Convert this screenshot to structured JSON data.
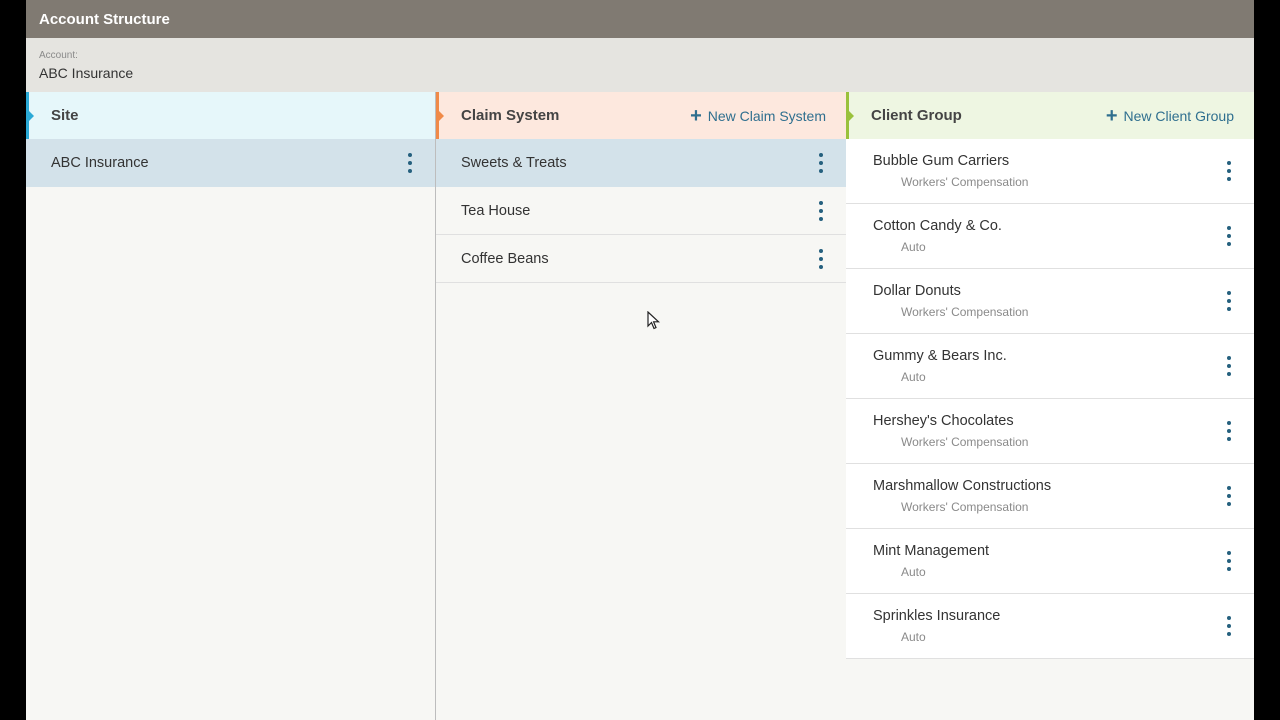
{
  "header": {
    "title": "Account Structure"
  },
  "account": {
    "label": "Account:",
    "name": "ABC Insurance"
  },
  "colors": {
    "site_accent": "#2aa9d6",
    "site_header_bg": "#e6f7fa",
    "claim_accent": "#f08a48",
    "claim_header_bg": "#fde8de",
    "client_accent": "#9ac13c",
    "client_header_bg": "#eef6e2"
  },
  "site": {
    "title": "Site",
    "items": [
      {
        "label": "ABC Insurance",
        "selected": true
      }
    ]
  },
  "claim_system": {
    "title": "Claim System",
    "new_label": "New Claim System",
    "items": [
      {
        "label": "Sweets & Treats",
        "selected": true
      },
      {
        "label": "Tea House",
        "selected": false
      },
      {
        "label": "Coffee Beans",
        "selected": false
      }
    ]
  },
  "client_group": {
    "title": "Client Group",
    "new_label": "New Client Group",
    "items": [
      {
        "name": "Bubble Gum Carriers",
        "type": "Workers' Compensation"
      },
      {
        "name": "Cotton Candy & Co.",
        "type": "Auto"
      },
      {
        "name": "Dollar Donuts",
        "type": "Workers' Compensation"
      },
      {
        "name": "Gummy & Bears Inc.",
        "type": "Auto"
      },
      {
        "name": "Hershey's Chocolates",
        "type": "Workers' Compensation"
      },
      {
        "name": "Marshmallow Constructions",
        "type": "Workers' Compensation"
      },
      {
        "name": "Mint Management",
        "type": "Auto"
      },
      {
        "name": "Sprinkles Insurance",
        "type": "Auto"
      }
    ]
  },
  "icons": {
    "more": "kebab-menu-icon",
    "add": "plus-icon",
    "cursor": "mouse-pointer-icon"
  }
}
